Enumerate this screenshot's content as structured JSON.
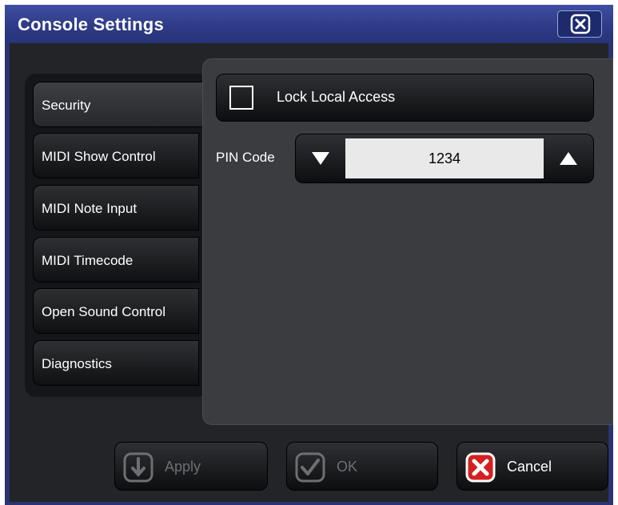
{
  "window": {
    "title": "Console Settings"
  },
  "tabs": [
    {
      "label": "Security",
      "active": true
    },
    {
      "label": "MIDI Show Control",
      "active": false
    },
    {
      "label": "MIDI Note Input",
      "active": false
    },
    {
      "label": "MIDI Timecode",
      "active": false
    },
    {
      "label": "Open Sound Control",
      "active": false
    },
    {
      "label": "Diagnostics",
      "active": false
    }
  ],
  "security": {
    "lock_local_access": {
      "label": "Lock Local Access",
      "checked": false
    },
    "pin_code": {
      "label": "PIN Code",
      "value": "1234"
    }
  },
  "buttons": {
    "apply": {
      "label": "Apply",
      "enabled": false
    },
    "ok": {
      "label": "OK",
      "enabled": false
    },
    "cancel": {
      "label": "Cancel",
      "enabled": true
    }
  },
  "icons": {
    "close": "close-icon",
    "decrement": "triangle-down-icon",
    "increment": "triangle-up-icon",
    "apply": "download-arrow-icon",
    "ok": "checkmark-icon",
    "cancel": "red-x-icon"
  },
  "colors": {
    "titlebar": "#2d3a86",
    "panel": "#3a3c40",
    "cancel_icon": "#d42020",
    "disabled_text": "#6d6f73"
  }
}
